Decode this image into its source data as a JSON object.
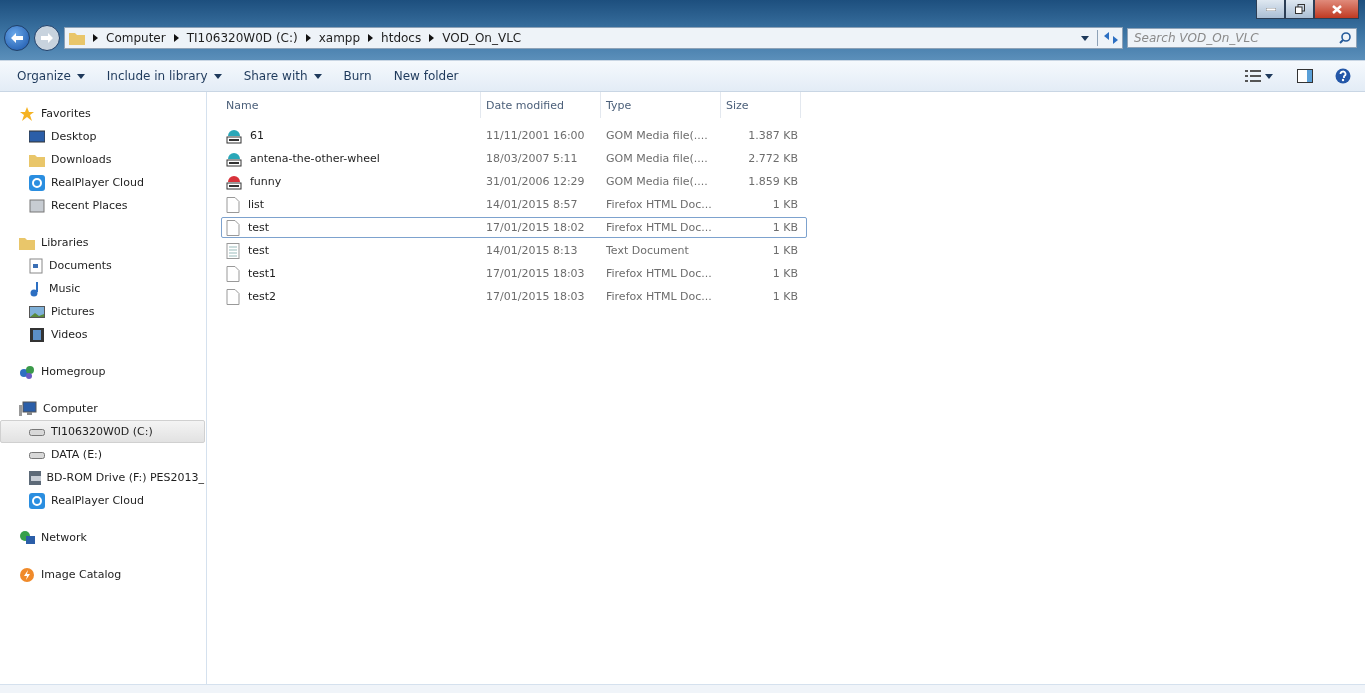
{
  "address": {
    "crumbs": [
      "Computer",
      "TI106320W0D (C:)",
      "xampp",
      "htdocs",
      "VOD_On_VLC"
    ]
  },
  "search": {
    "placeholder": "Search VOD_On_VLC"
  },
  "toolbar": [
    {
      "label": "Organize",
      "dropdown": true
    },
    {
      "label": "Include in library",
      "dropdown": true
    },
    {
      "label": "Share with",
      "dropdown": true
    },
    {
      "label": "Burn",
      "dropdown": false
    },
    {
      "label": "New folder",
      "dropdown": false
    }
  ],
  "sidebar": [
    {
      "label": "Favorites",
      "kind": "star",
      "children": [
        {
          "label": "Desktop",
          "kind": "desktop",
          "selected": false
        },
        {
          "label": "Downloads",
          "kind": "folder",
          "selected": false
        },
        {
          "label": "RealPlayer Cloud",
          "kind": "cloud",
          "selected": false
        },
        {
          "label": "Recent Places",
          "kind": "recent",
          "selected": false
        }
      ]
    },
    {
      "label": "Libraries",
      "kind": "folder",
      "children": [
        {
          "label": "Documents",
          "kind": "doc",
          "selected": false
        },
        {
          "label": "Music",
          "kind": "music",
          "selected": false
        },
        {
          "label": "Pictures",
          "kind": "picture",
          "selected": false
        },
        {
          "label": "Videos",
          "kind": "video",
          "selected": false
        }
      ]
    },
    {
      "label": "Homegroup",
      "kind": "homegroup"
    },
    {
      "label": "Computer",
      "kind": "computer",
      "children": [
        {
          "label": "TI106320W0D (C:)",
          "kind": "drive",
          "selected": true
        },
        {
          "label": "DATA (E:)",
          "kind": "drive",
          "selected": false
        },
        {
          "label": "BD-ROM Drive (F:) PES2013_",
          "kind": "disc",
          "selected": false
        },
        {
          "label": "RealPlayer Cloud",
          "kind": "cloud",
          "selected": false
        }
      ]
    },
    {
      "label": "Network",
      "kind": "network"
    },
    {
      "label": "Image Catalog",
      "kind": "bolt"
    }
  ],
  "table": {
    "columns": [
      "Name",
      "Date modified",
      "Type",
      "Size"
    ],
    "rows": [
      {
        "name": "61",
        "date": "11/11/2001 16:00",
        "type": "GOM Media file(....",
        "size": "1.387 KB",
        "kind": "mpg",
        "focused": false
      },
      {
        "name": "antena-the-other-wheel",
        "date": "18/03/2007 5:11",
        "type": "GOM Media file(....",
        "size": "2.772 KB",
        "kind": "mpg",
        "focused": false
      },
      {
        "name": "funny",
        "date": "31/01/2006 12:29",
        "type": "GOM Media file(....",
        "size": "1.859 KB",
        "kind": "wmv",
        "focused": false
      },
      {
        "name": "list",
        "date": "14/01/2015 8:57",
        "type": "Firefox HTML Doc...",
        "size": "1 KB",
        "kind": "blank",
        "focused": false
      },
      {
        "name": "test",
        "date": "17/01/2015 18:02",
        "type": "Firefox HTML Doc...",
        "size": "1 KB",
        "kind": "blank",
        "focused": true
      },
      {
        "name": "test",
        "date": "14/01/2015 8:13",
        "type": "Text Document",
        "size": "1 KB",
        "kind": "text",
        "focused": false
      },
      {
        "name": "test1",
        "date": "17/01/2015 18:03",
        "type": "Firefox HTML Doc...",
        "size": "1 KB",
        "kind": "blank",
        "focused": false
      },
      {
        "name": "test2",
        "date": "17/01/2015 18:03",
        "type": "Firefox HTML Doc...",
        "size": "1 KB",
        "kind": "blank",
        "focused": false
      }
    ]
  }
}
